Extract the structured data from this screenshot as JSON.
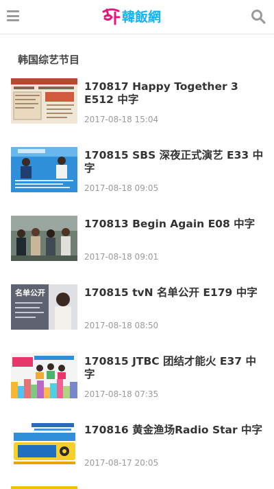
{
  "header": {
    "logo_text": "韓飯網",
    "menu_icon": "hamburger-menu-icon",
    "search_icon": "search-icon"
  },
  "section": {
    "title": "韩国综艺节目"
  },
  "articles": [
    {
      "title": "170817 Happy Together 3 E512 中字",
      "time": "2017-08-18 15:04"
    },
    {
      "title": "170815 SBS 深夜正式演艺 E33 中字",
      "time": "2017-08-18 09:05"
    },
    {
      "title": "170813 Begin Again E08 中字",
      "time": "2017-08-18 09:01"
    },
    {
      "title": "170815 tvN 名单公开 E179 中字",
      "time": "2017-08-18 08:50",
      "thumb_text": "名单公开"
    },
    {
      "title": "170815 JTBC 团结才能火 E37 中字",
      "time": "2017-08-18 07:35"
    },
    {
      "title": "170816 黄金渔场Radio Star 中字",
      "time": "2017-08-17 20:05"
    }
  ],
  "colors": {
    "logo_blue": "#12b4ef",
    "logo_pink": "#e5157e",
    "muted_gray": "#9a9a9a"
  }
}
